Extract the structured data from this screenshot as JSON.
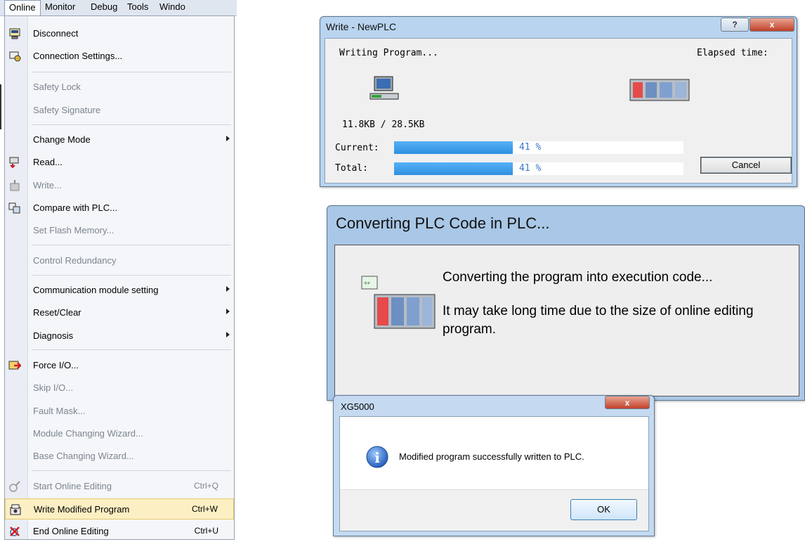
{
  "menubar": {
    "items": [
      "Online",
      "Monitor",
      "Debug",
      "Tools",
      "Windo"
    ]
  },
  "menu": {
    "items": [
      {
        "label": "Disconnect",
        "icon": "disconnect-icon",
        "enabled": true
      },
      {
        "label": "Connection Settings...",
        "icon": "connection-settings-icon",
        "enabled": true
      },
      {
        "label": "Safety Lock",
        "enabled": false
      },
      {
        "label": "Safety Signature",
        "enabled": false
      },
      {
        "label": "Change Mode",
        "enabled": true,
        "submenu": true
      },
      {
        "label": "Read...",
        "icon": "read-icon",
        "enabled": true
      },
      {
        "label": "Write...",
        "icon": "write-icon",
        "enabled": false
      },
      {
        "label": "Compare with PLC...",
        "icon": "compare-icon",
        "enabled": true
      },
      {
        "label": "Set Flash Memory...",
        "enabled": false
      },
      {
        "label": "Control Redundancy",
        "enabled": false
      },
      {
        "label": "Communication module setting",
        "enabled": true,
        "submenu": true
      },
      {
        "label": "Reset/Clear",
        "enabled": true,
        "submenu": true
      },
      {
        "label": "Diagnosis",
        "enabled": true,
        "submenu": true
      },
      {
        "label": "Force I/O...",
        "icon": "force-io-icon",
        "enabled": true
      },
      {
        "label": "Skip I/O...",
        "enabled": false
      },
      {
        "label": "Fault Mask...",
        "enabled": false
      },
      {
        "label": "Module Changing Wizard...",
        "enabled": false
      },
      {
        "label": "Base Changing Wizard...",
        "enabled": false
      },
      {
        "label": "Start Online Editing",
        "icon": "start-online-editing-icon",
        "shortcut": "Ctrl+Q",
        "enabled": false
      },
      {
        "label": "Write Modified Program",
        "icon": "write-modified-icon",
        "shortcut": "Ctrl+W",
        "enabled": true,
        "highlighted": true
      },
      {
        "label": "End Online Editing",
        "icon": "end-online-editing-icon",
        "shortcut": "Ctrl+U",
        "enabled": true
      }
    ]
  },
  "write_dialog": {
    "title": "Write - NewPLC",
    "status": "Writing Program...",
    "elapsed_label": "Elapsed time:",
    "size_text": "11.8KB / 28.5KB",
    "current_label": "Current:",
    "total_label": "Total:",
    "current_percent": "41 %",
    "total_percent": "41 %",
    "current_progress": 0.41,
    "total_progress": 0.41,
    "cancel_label": "Cancel",
    "help_label": "?",
    "close_label": "x"
  },
  "convert_dialog": {
    "title": "Converting PLC Code in PLC...",
    "line1": "Converting the program into execution code...",
    "line2": "It may take long time due to the size of online editing",
    "line3": "program."
  },
  "message_box": {
    "title": "XG5000",
    "message": "Modified program successfully written to PLC.",
    "ok_label": "OK",
    "close_label": "x",
    "info_glyph": "i"
  },
  "colors": {
    "highlight": "#fcefc3",
    "progress": "#2f8fe0",
    "disabled_text": "#7d8590"
  }
}
